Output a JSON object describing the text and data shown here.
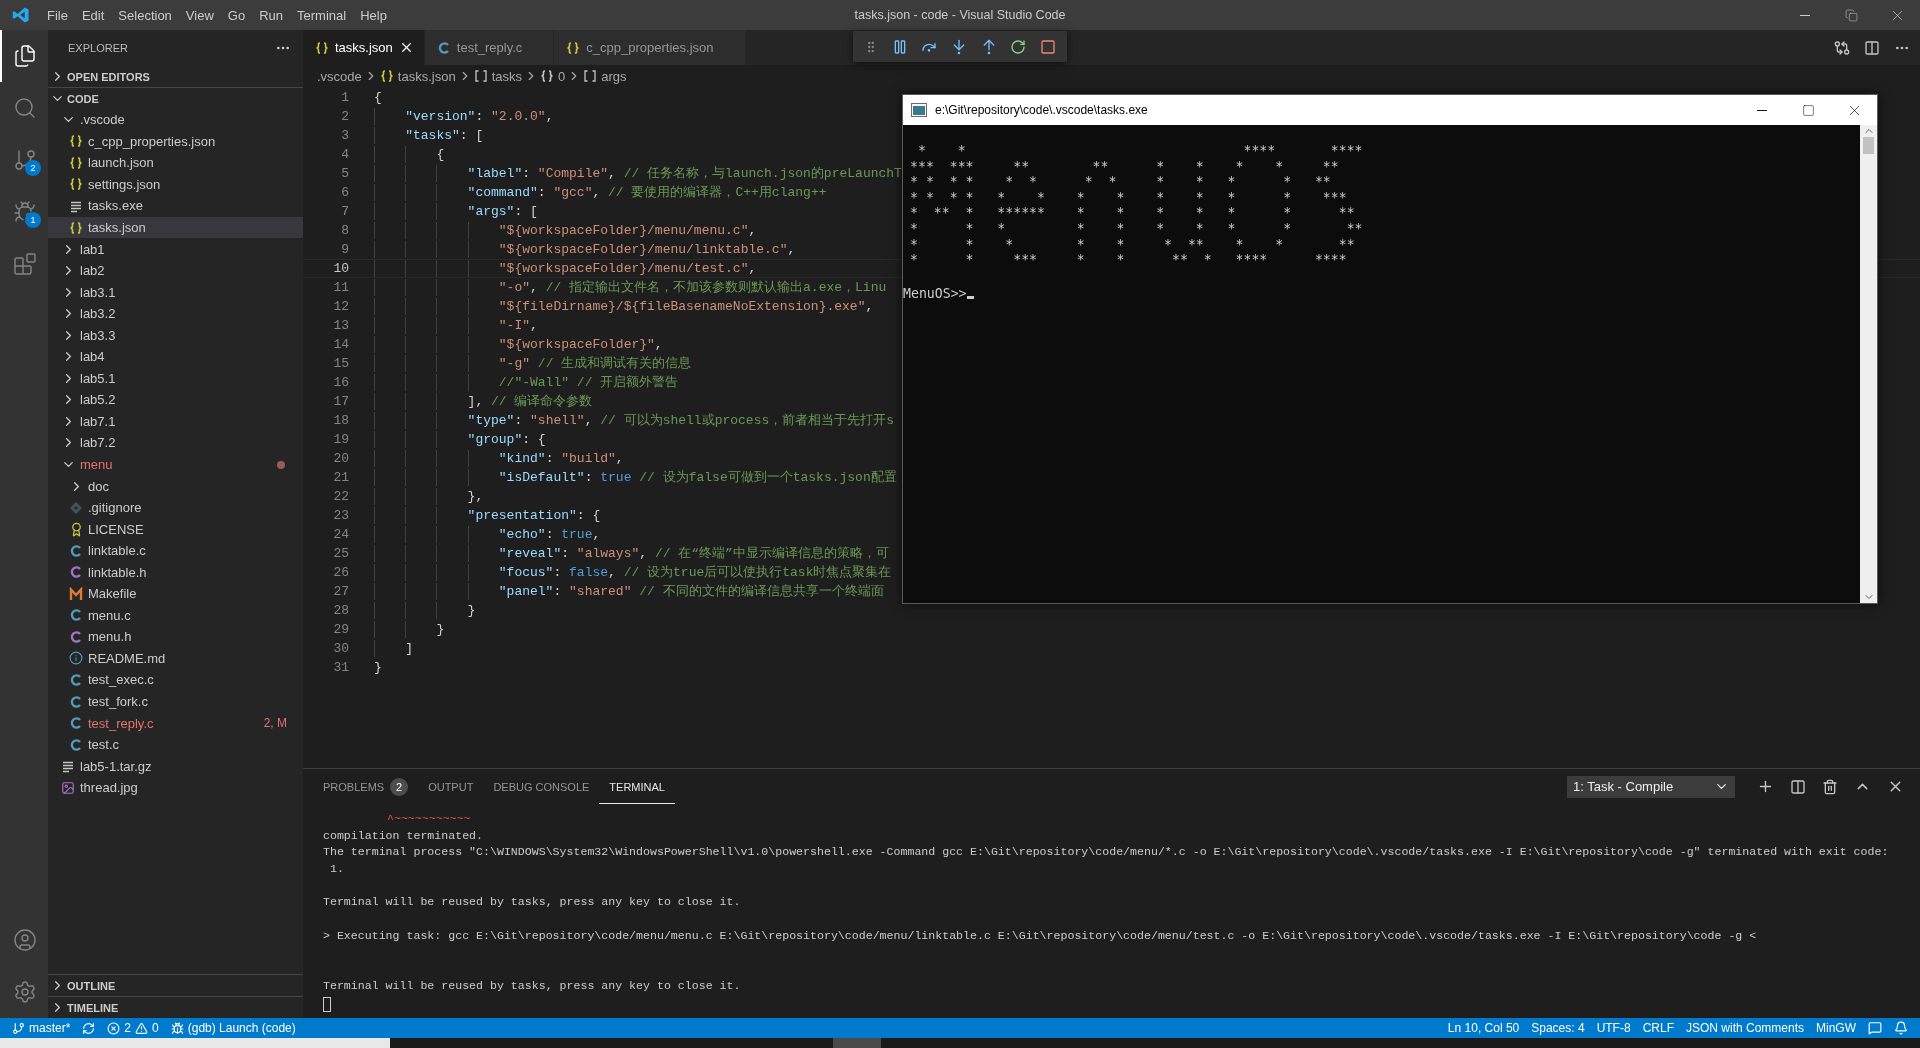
{
  "window": {
    "title": "tasks.json - code - Visual Studio Code"
  },
  "menu": [
    "File",
    "Edit",
    "Selection",
    "View",
    "Go",
    "Run",
    "Terminal",
    "Help"
  ],
  "activity_bar": [
    {
      "kind": "explorer",
      "selected": true
    },
    {
      "kind": "search",
      "selected": false
    },
    {
      "kind": "source-control",
      "selected": false,
      "badge": "2"
    },
    {
      "kind": "debug",
      "selected": false,
      "badge": "1"
    },
    {
      "kind": "extensions",
      "selected": false
    }
  ],
  "activity_bar_bottom": [
    {
      "kind": "account"
    },
    {
      "kind": "settings"
    }
  ],
  "sidebar": {
    "title": "EXPLORER",
    "sections": [
      {
        "label": "OPEN EDITORS",
        "expanded": false
      },
      {
        "label": "CODE",
        "expanded": true,
        "children": [
          {
            "name": ".vscode",
            "kind": "folder",
            "expanded": true,
            "selected": false,
            "modified": false,
            "children": [
              {
                "name": "c_cpp_properties.json",
                "kind": "json",
                "selected": false,
                "modified": false
              },
              {
                "name": "launch.json",
                "kind": "json",
                "selected": false,
                "modified": false
              },
              {
                "name": "settings.json",
                "kind": "json",
                "selected": false,
                "modified": false
              },
              {
                "name": "tasks.exe",
                "kind": "binary",
                "selected": false,
                "modified": false
              },
              {
                "name": "tasks.json",
                "kind": "json",
                "selected": true,
                "modified": false
              }
            ]
          },
          {
            "name": "lab1",
            "kind": "folder",
            "expanded": false,
            "selected": false,
            "modified": false
          },
          {
            "name": "lab2",
            "kind": "folder",
            "expanded": false,
            "selected": false,
            "modified": false
          },
          {
            "name": "lab3.1",
            "kind": "folder",
            "expanded": false,
            "selected": false,
            "modified": false
          },
          {
            "name": "lab3.2",
            "kind": "folder",
            "expanded": false,
            "selected": false,
            "modified": false
          },
          {
            "name": "lab3.3",
            "kind": "folder",
            "expanded": false,
            "selected": false,
            "modified": false
          },
          {
            "name": "lab4",
            "kind": "folder",
            "expanded": false,
            "selected": false,
            "modified": false
          },
          {
            "name": "lab5.1",
            "kind": "folder",
            "expanded": false,
            "selected": false,
            "modified": false
          },
          {
            "name": "lab5.2",
            "kind": "folder",
            "expanded": false,
            "selected": false,
            "modified": false
          },
          {
            "name": "lab7.1",
            "kind": "folder",
            "expanded": false,
            "selected": false,
            "modified": false
          },
          {
            "name": "lab7.2",
            "kind": "folder",
            "expanded": false,
            "selected": false,
            "modified": false
          },
          {
            "name": "menu",
            "kind": "folder",
            "expanded": true,
            "selected": false,
            "modified": true,
            "children": [
              {
                "name": "doc",
                "kind": "folder",
                "expanded": false,
                "selected": false,
                "modified": false
              },
              {
                "name": ".gitignore",
                "kind": "gitignore",
                "selected": false,
                "modified": false
              },
              {
                "name": "LICENSE",
                "kind": "license",
                "selected": false,
                "modified": false
              },
              {
                "name": "linktable.c",
                "kind": "c",
                "selected": false,
                "modified": false
              },
              {
                "name": "linktable.h",
                "kind": "h",
                "selected": false,
                "modified": false
              },
              {
                "name": "Makefile",
                "kind": "makefile",
                "selected": false,
                "modified": false
              },
              {
                "name": "menu.c",
                "kind": "c",
                "selected": false,
                "modified": false
              },
              {
                "name": "menu.h",
                "kind": "h",
                "selected": false,
                "modified": false
              },
              {
                "name": "README.md",
                "kind": "readme",
                "selected": false,
                "modified": false
              },
              {
                "name": "test_exec.c",
                "kind": "c",
                "selected": false,
                "modified": false
              },
              {
                "name": "test_fork.c",
                "kind": "c",
                "selected": false,
                "modified": false
              },
              {
                "name": "test_reply.c",
                "kind": "c",
                "selected": false,
                "modified": true,
                "badge": "2, M"
              },
              {
                "name": "test.c",
                "kind": "c",
                "selected": false,
                "modified": false
              }
            ]
          },
          {
            "name": "lab5-1.tar.gz",
            "kind": "binary",
            "selected": false,
            "modified": false
          },
          {
            "name": "thread.jpg",
            "kind": "image",
            "selected": false,
            "modified": false
          }
        ]
      }
    ],
    "bottom_sections": [
      {
        "label": "OUTLINE",
        "expanded": false
      },
      {
        "label": "TIMELINE",
        "expanded": false
      }
    ]
  },
  "tabs": [
    {
      "label": "tasks.json",
      "kind": "json",
      "selected": true
    },
    {
      "label": "test_reply.c",
      "kind": "c",
      "selected": false
    },
    {
      "label": "c_cpp_properties.json",
      "kind": "json",
      "selected": false
    }
  ],
  "breadcrumb": [
    {
      "label": ".vscode",
      "kind": "folder"
    },
    {
      "label": "tasks.json",
      "kind": "json"
    },
    {
      "label": "tasks",
      "kind": "array"
    },
    {
      "label": "0",
      "kind": "object"
    },
    {
      "label": "args",
      "kind": "array"
    }
  ],
  "debug_toolbar": [
    {
      "kind": "pause"
    },
    {
      "kind": "step-over"
    },
    {
      "kind": "step-into"
    },
    {
      "kind": "step-out"
    },
    {
      "kind": "restart"
    },
    {
      "kind": "stop"
    }
  ],
  "editor": {
    "lines": [
      {
        "number": "1",
        "text": "{",
        "current": false
      },
      {
        "number": "2",
        "text": "    \"version\": \"2.0.0\",",
        "current": false
      },
      {
        "number": "3",
        "text": "    \"tasks\": [",
        "current": false
      },
      {
        "number": "4",
        "text": "        {",
        "current": false
      },
      {
        "number": "5",
        "text": "            \"label\": \"Compile\", // 任务名称，与launch.json的preLaunchT",
        "current": false
      },
      {
        "number": "6",
        "text": "            \"command\": \"gcc\", // 要使用的编译器，C++用clang++",
        "current": false
      },
      {
        "number": "7",
        "text": "            \"args\": [",
        "current": false
      },
      {
        "number": "8",
        "text": "                \"${workspaceFolder}/menu/menu.c\",",
        "current": false
      },
      {
        "number": "9",
        "text": "                \"${workspaceFolder}/menu/linktable.c\",",
        "current": false
      },
      {
        "number": "10",
        "text": "                \"${workspaceFolder}/menu/test.c\",",
        "current": true
      },
      {
        "number": "11",
        "text": "                \"-o\", // 指定输出文件名，不加该参数则默认输出a.exe，Linu",
        "current": false
      },
      {
        "number": "12",
        "text": "                \"${fileDirname}/${fileBasenameNoExtension}.exe\",",
        "current": false
      },
      {
        "number": "13",
        "text": "                \"-I\",",
        "current": false
      },
      {
        "number": "14",
        "text": "                \"${workspaceFolder}\",",
        "current": false
      },
      {
        "number": "15",
        "text": "                \"-g\" // 生成和调试有关的信息",
        "current": false
      },
      {
        "number": "16",
        "text": "                //\"-Wall\" // 开启额外警告",
        "current": false
      },
      {
        "number": "17",
        "text": "            ], // 编译命令参数",
        "current": false
      },
      {
        "number": "18",
        "text": "            \"type\": \"shell\", // 可以为shell或process，前者相当于先打开s",
        "current": false
      },
      {
        "number": "19",
        "text": "            \"group\": {",
        "current": false
      },
      {
        "number": "20",
        "text": "                \"kind\": \"build\",",
        "current": false
      },
      {
        "number": "21",
        "text": "                \"isDefault\": true // 设为false可做到一个tasks.json配置",
        "current": false
      },
      {
        "number": "22",
        "text": "            },",
        "current": false
      },
      {
        "number": "23",
        "text": "            \"presentation\": {",
        "current": false
      },
      {
        "number": "24",
        "text": "                \"echo\": true,",
        "current": false
      },
      {
        "number": "25",
        "text": "                \"reveal\": \"always\", // 在“终端”中显示编译信息的策略，可",
        "current": false
      },
      {
        "number": "26",
        "text": "                \"focus\": false, // 设为true后可以使执行task时焦点聚集在",
        "current": false
      },
      {
        "number": "27",
        "text": "                \"panel\": \"shared\" // 不同的文件的编译信息共享一个终端面",
        "current": false
      },
      {
        "number": "28",
        "text": "            }",
        "current": false
      },
      {
        "number": "29",
        "text": "        }",
        "current": false
      },
      {
        "number": "30",
        "text": "    ]",
        "current": false
      },
      {
        "number": "31",
        "text": "}",
        "current": false
      }
    ]
  },
  "console_window": {
    "title": "e:\\Git\\repository\\code\\.vscode\\tasks.exe",
    "art": " *    *                                   ****       ****\n***  ***     **        **      *    *    *    *     **\n* *  * *    *  *      *  *     *    *   *      *   **\n* *  * *   *    *    *    *    *    *   *      *    ***\n*  **  *   ******    *    *    *    *   *      *      **\n*      *   *         *    *    *    *   *      *       **\n*      *    *        *    *     *  **    *    *       **\n*      *     ***     *    *      **  *   ****      ****",
    "prompt": "MenuOS>>"
  },
  "panel": {
    "tabs": [
      {
        "label": "PROBLEMS",
        "badge": "2",
        "selected": false
      },
      {
        "label": "OUTPUT",
        "selected": false
      },
      {
        "label": "DEBUG CONSOLE",
        "selected": false
      },
      {
        "label": "TERMINAL",
        "selected": true
      }
    ],
    "terminal_select": "1: Task - Compile",
    "terminal": [
      {
        "kind": "squiggle",
        "text": "^~~~~~~~~~~~"
      },
      {
        "kind": "text",
        "text": "compilation terminated."
      },
      {
        "kind": "text",
        "text": "The terminal process \"C:\\WINDOWS\\System32\\WindowsPowerShell\\v1.0\\powershell.exe -Command gcc E:\\Git\\repository\\code/menu/*.c -o E:\\Git\\repository\\code\\.vscode/tasks.exe -I E:\\Git\\repository\\code -g\" terminated with exit code:"
      },
      {
        "kind": "text",
        "text": " 1."
      },
      {
        "kind": "blank"
      },
      {
        "kind": "text",
        "text": "Terminal will be reused by tasks, press any key to close it."
      },
      {
        "kind": "blank"
      },
      {
        "kind": "text",
        "text": "> Executing task: gcc E:\\Git\\repository\\code/menu/menu.c E:\\Git\\repository\\code/menu/linktable.c E:\\Git\\repository\\code/menu/test.c -o E:\\Git\\repository\\code\\.vscode/tasks.exe -I E:\\Git\\repository\\code -g <"
      },
      {
        "kind": "blank"
      },
      {
        "kind": "blank"
      },
      {
        "kind": "text",
        "text": "Terminal will be reused by tasks, press any key to close it."
      }
    ],
    "cursor": true
  },
  "status_bar": {
    "left": [
      {
        "kind": "branch",
        "text": "master*"
      },
      {
        "kind": "sync"
      },
      {
        "kind": "problems",
        "errors": "2",
        "warnings": "0"
      },
      {
        "kind": "debug",
        "text": "(gdb) Launch (code)"
      }
    ],
    "right": [
      {
        "kind": "text",
        "text": "Ln 10, Col 50"
      },
      {
        "kind": "text",
        "text": "Spaces: 4"
      },
      {
        "kind": "text",
        "text": "UTF-8"
      },
      {
        "kind": "text",
        "text": "CRLF"
      },
      {
        "kind": "text",
        "text": "JSON with Comments"
      },
      {
        "kind": "text",
        "text": "MinGW"
      },
      {
        "kind": "feedback"
      },
      {
        "kind": "bell"
      }
    ]
  }
}
